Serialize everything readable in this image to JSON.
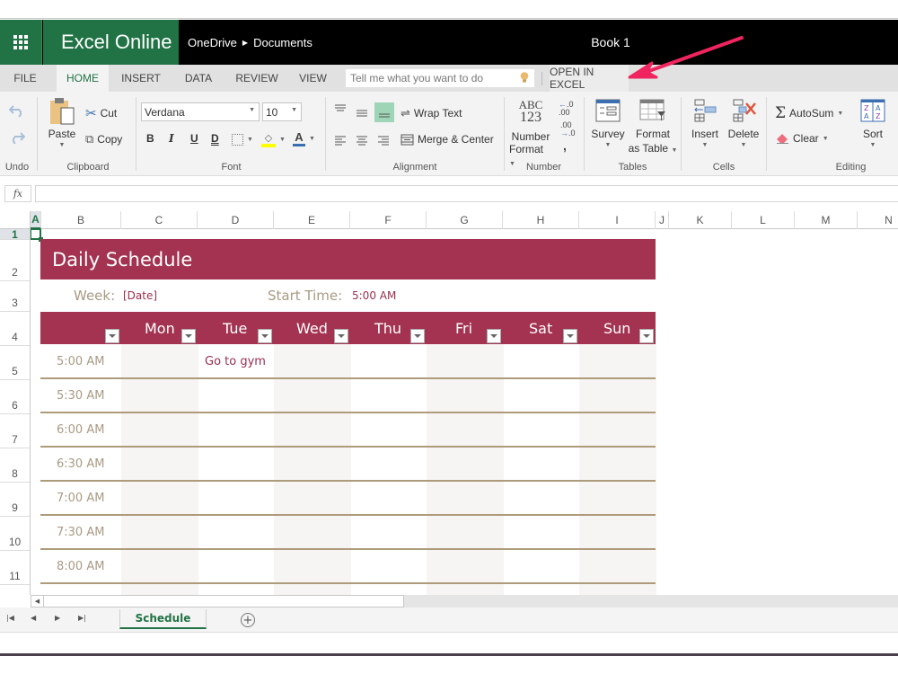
{
  "app": {
    "brand": "Excel Online",
    "breadcrumb": [
      "OneDrive",
      "Documents"
    ],
    "doc_title": "Book 1"
  },
  "tabs": [
    "FILE",
    "HOME",
    "INSERT",
    "DATA",
    "REVIEW",
    "VIEW"
  ],
  "active_tab": "HOME",
  "tell_me_placeholder": "Tell me what you want to do",
  "open_in_excel": "OPEN IN EXCEL",
  "ribbon": {
    "undo_group": "Undo",
    "clipboard": {
      "label": "Clipboard",
      "paste": "Paste",
      "cut": "Cut",
      "copy": "Copy"
    },
    "font": {
      "label": "Font",
      "family": "Verdana",
      "size": "10",
      "bold": "B",
      "italic": "I",
      "underline": "U",
      "double_underline": "D",
      "font_color_glyph": "A"
    },
    "alignment": {
      "label": "Alignment",
      "wrap": "Wrap Text",
      "merge": "Merge & Center"
    },
    "number": {
      "label": "Number",
      "abc": "ABC",
      "n123": "123",
      "format_line1": "Number",
      "format_line2": "Format",
      "inc_decimal": ".00",
      "dec_decimal": ".0",
      "comma": ","
    },
    "tables": {
      "label": "Tables",
      "survey": "Survey",
      "format_table_1": "Format",
      "format_table_2": "as Table"
    },
    "cells": {
      "label": "Cells",
      "insert": "Insert",
      "delete": "Delete"
    },
    "editing": {
      "label": "Editing",
      "autosum": "AutoSum",
      "clear": "Clear",
      "sort": "Sort"
    }
  },
  "formula_bar": {
    "fx": "fx",
    "value": ""
  },
  "columns": [
    "A",
    "B",
    "C",
    "D",
    "E",
    "F",
    "G",
    "H",
    "I",
    "J",
    "K",
    "L",
    "M",
    "N"
  ],
  "rows": [
    "1",
    "2",
    "3",
    "4",
    "5",
    "6",
    "7",
    "8",
    "9",
    "10",
    "11"
  ],
  "schedule": {
    "title": "Daily Schedule",
    "week_label": "Week:",
    "week_value": "[Date]",
    "start_label": "Start Time:",
    "start_value": "5:00 AM",
    "days": [
      "Mon",
      "Tue",
      "Wed",
      "Thu",
      "Fri",
      "Sat",
      "Sun"
    ],
    "times": [
      "5:00 AM",
      "5:30 AM",
      "6:00 AM",
      "6:30 AM",
      "7:00 AM",
      "7:30 AM",
      "8:00 AM"
    ],
    "entries": [
      {
        "time": "5:00 AM",
        "day": "Tue",
        "text": "Go to gym"
      }
    ]
  },
  "sheet_tabs": [
    "Schedule"
  ],
  "colors": {
    "excel_green": "#217346",
    "header_band": "#a33351",
    "slot_line": "#ad9b7b",
    "label_tan": "#a99a83",
    "annotation_arrow": "#f0245f"
  }
}
